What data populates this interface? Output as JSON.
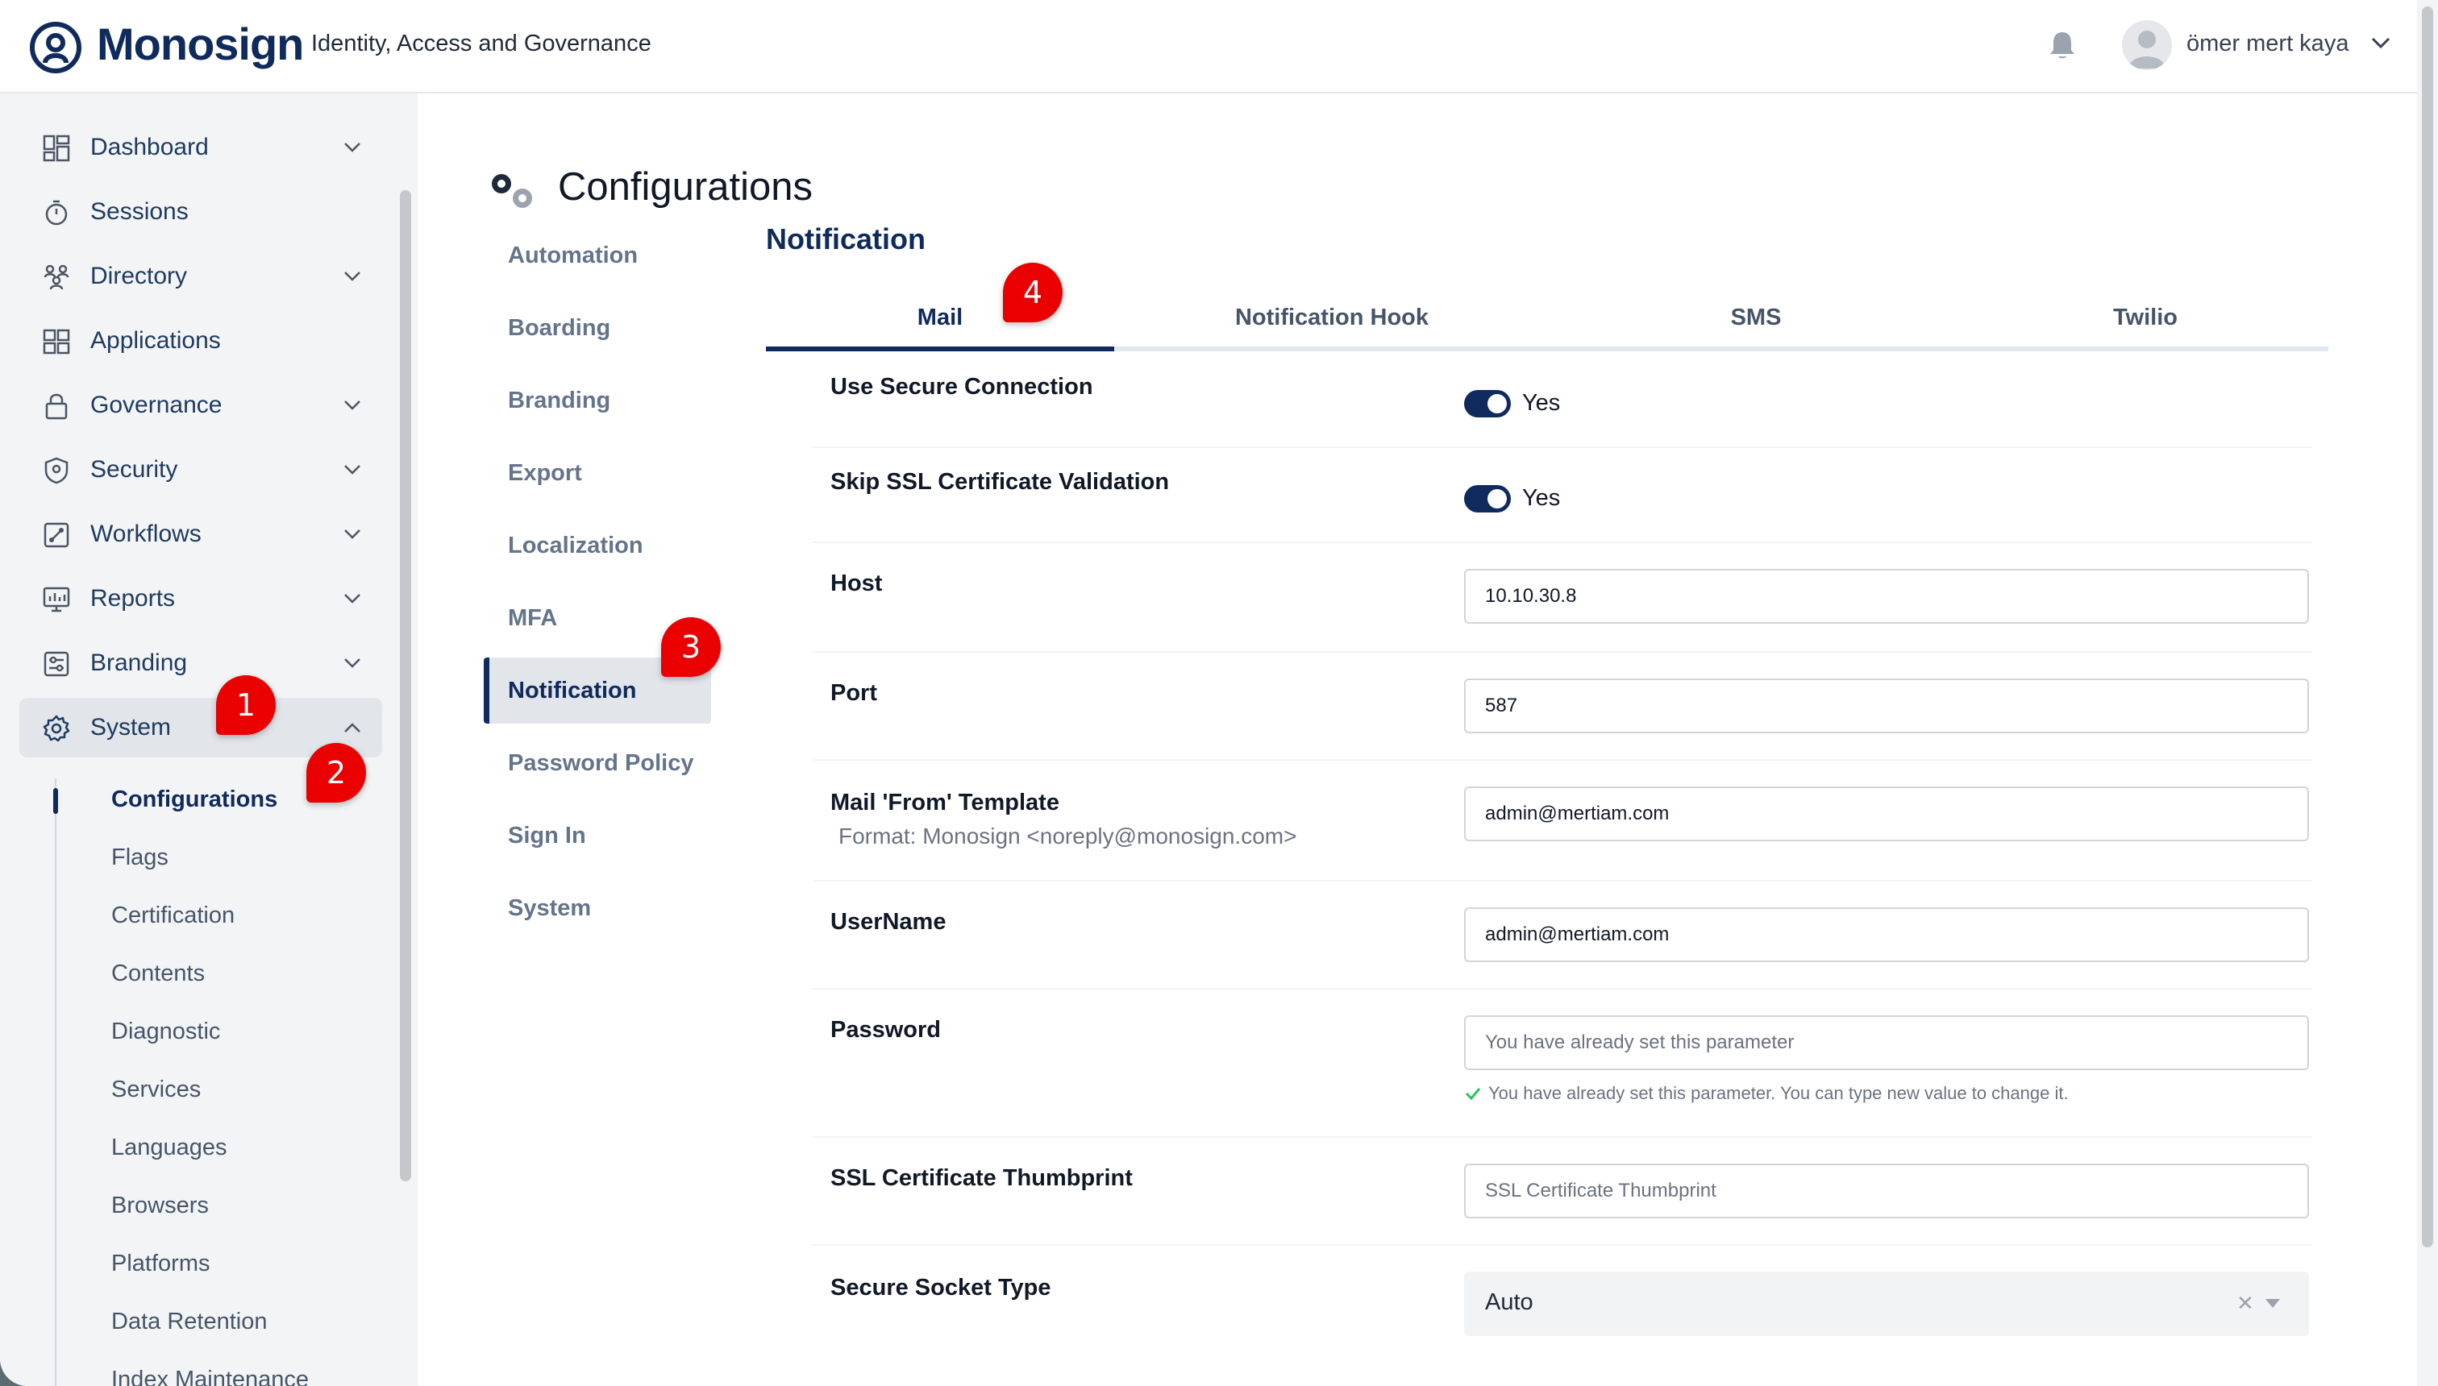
{
  "header": {
    "brand": "Monosign",
    "tagline": "Identity, Access and Governance",
    "user_name": "ömer mert kaya"
  },
  "sidebar": {
    "items": [
      {
        "label": "Dashboard",
        "icon": "dashboard-icon",
        "expandable": true
      },
      {
        "label": "Sessions",
        "icon": "stopwatch-icon",
        "expandable": false
      },
      {
        "label": "Directory",
        "icon": "users-icon",
        "expandable": true
      },
      {
        "label": "Applications",
        "icon": "apps-grid-icon",
        "expandable": false
      },
      {
        "label": "Governance",
        "icon": "lock-icon",
        "expandable": true
      },
      {
        "label": "Security",
        "icon": "shield-icon",
        "expandable": true
      },
      {
        "label": "Workflows",
        "icon": "workflow-icon",
        "expandable": true
      },
      {
        "label": "Reports",
        "icon": "monitor-chart-icon",
        "expandable": true
      },
      {
        "label": "Branding",
        "icon": "sliders-icon",
        "expandable": true
      },
      {
        "label": "System",
        "icon": "gear-icon",
        "expandable": true,
        "expanded": true
      }
    ],
    "subitems": [
      "Configurations",
      "Flags",
      "Certification",
      "Contents",
      "Diagnostic",
      "Services",
      "Languages",
      "Browsers",
      "Platforms",
      "Data Retention",
      "Index Maintenance"
    ],
    "active_subitem": "Configurations"
  },
  "page": {
    "title": "Configurations",
    "config_menu": [
      "Automation",
      "Boarding",
      "Branding",
      "Export",
      "Localization",
      "MFA",
      "Notification",
      "Password Policy",
      "Sign In",
      "System"
    ],
    "active_config": "Notification",
    "section_title": "Notification",
    "tabs": [
      "Mail",
      "Notification Hook",
      "SMS",
      "Twilio"
    ],
    "active_tab": "Mail"
  },
  "form": {
    "use_secure_connection": {
      "label": "Use Secure Connection",
      "value": "Yes",
      "on": true
    },
    "skip_ssl_validation": {
      "label": "Skip SSL Certificate Validation",
      "value": "Yes",
      "on": true
    },
    "host": {
      "label": "Host",
      "value": "10.10.30.8"
    },
    "port": {
      "label": "Port",
      "value": "587"
    },
    "mail_from": {
      "label": "Mail 'From' Template",
      "hint": "Format: Monosign <noreply@monosign.com>",
      "value": "admin@mertiam.com"
    },
    "username": {
      "label": "UserName",
      "value": "admin@mertiam.com"
    },
    "password": {
      "label": "Password",
      "placeholder": "You have already set this parameter",
      "help": "You have already set this parameter. You can type new value to change it."
    },
    "ssl_thumbprint": {
      "label": "SSL Certificate Thumbprint",
      "placeholder": "SSL Certificate Thumbprint"
    },
    "secure_socket_type": {
      "label": "Secure Socket Type",
      "value": "Auto"
    }
  },
  "callouts": [
    "1",
    "2",
    "3",
    "4"
  ],
  "colors": {
    "brand": "#0f2a5c",
    "callout": "#ea0000",
    "sidebar_bg": "#f3f4f6"
  }
}
